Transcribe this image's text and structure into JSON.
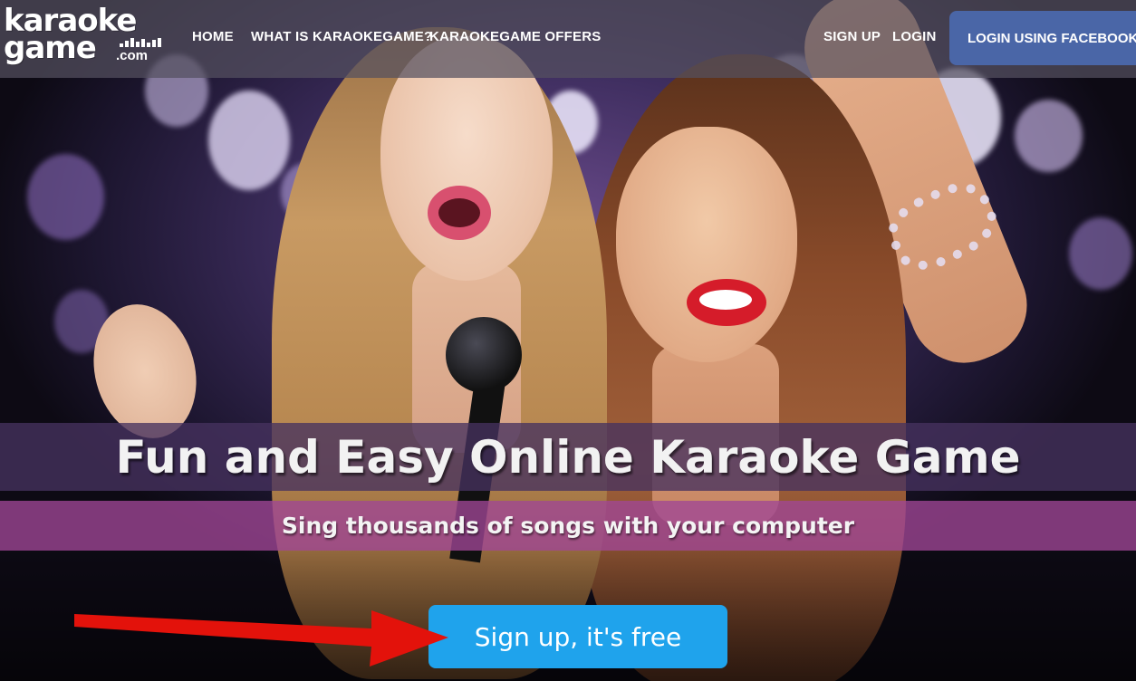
{
  "brand": {
    "logo_line1": "karaoke",
    "logo_line2": "game",
    "logo_suffix": ".com"
  },
  "nav": {
    "items": [
      {
        "label": "HOME"
      },
      {
        "label": "WHAT IS KARAOKEGAME?"
      },
      {
        "label": "KARAOKEGAME OFFERS"
      }
    ],
    "sign_up": "SIGN UP",
    "login": "LOGIN",
    "facebook_login": "LOGIN USING FACEBOOK"
  },
  "hero": {
    "headline": "Fun and Easy Online Karaoke Game",
    "subheadline": "Sing thousands of songs with your computer",
    "cta": "Sign up, it's free"
  },
  "colors": {
    "facebook_button": "#4a66a7",
    "cta_button": "#1fa3ec",
    "annotation_arrow": "#e3120b",
    "headline_band": "#46325f",
    "subheadline_band": "#a04696"
  },
  "icons": {
    "annotation": "red-arrow-icon"
  }
}
